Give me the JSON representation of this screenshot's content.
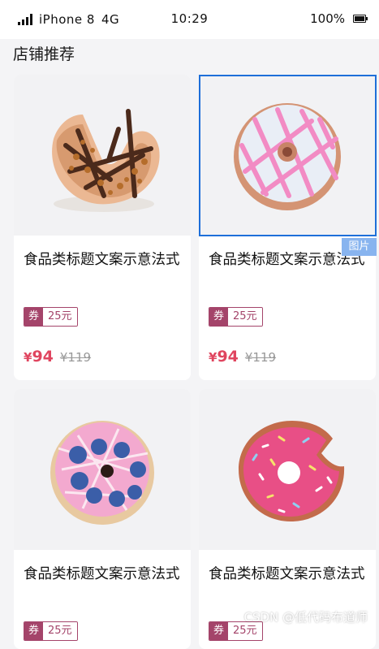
{
  "status_bar": {
    "carrier": "iPhone 8",
    "network": "4G",
    "time": "10:29",
    "battery": "100%"
  },
  "section": {
    "title": "店铺推荐"
  },
  "products": [
    {
      "image": "chocolate-donut-image",
      "title": "食品类标题文案示意法式",
      "coupon_tag": "券",
      "coupon_amount": "25元",
      "price_symbol": "¥",
      "price": "94",
      "original_price": "¥119"
    },
    {
      "image": "white-icing-donut-image",
      "title": "食品类标题文案示意法式",
      "coupon_tag": "券",
      "coupon_amount": "25元",
      "price_symbol": "¥",
      "price": "94",
      "original_price": "¥119"
    },
    {
      "image": "blueberry-donut-image",
      "title": "食品类标题文案示意法式",
      "coupon_tag": "券",
      "coupon_amount": "25元",
      "price_symbol": "",
      "price": "",
      "original_price": ""
    },
    {
      "image": "pink-sprinkle-donut-image",
      "title": "食品类标题文案示意法式",
      "coupon_tag": "券",
      "coupon_amount": "25元",
      "price_symbol": "",
      "price": "",
      "original_price": ""
    }
  ],
  "selection_tag": "图片",
  "watermark": "CSDN @低代码布道师",
  "colors": {
    "accent_price": "#e0455f",
    "coupon": "#a4446a",
    "selection": "#1e6fd9"
  }
}
